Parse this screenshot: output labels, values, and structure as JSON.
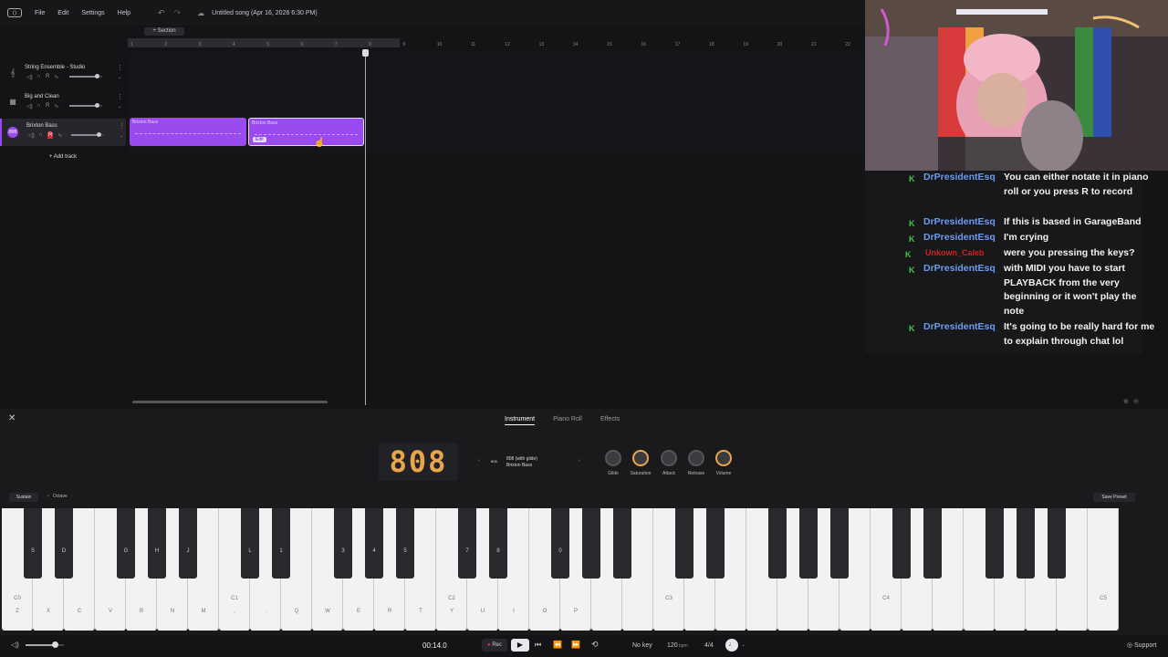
{
  "menu": {
    "items": [
      "File",
      "Edit",
      "Settings",
      "Help"
    ],
    "song_title": "Untitled song (Apr 16, 2026 6:30 PM)"
  },
  "arrangement": {
    "section_button": "+ Section",
    "ruler": [
      "1",
      "2",
      "3",
      "4",
      "5",
      "6",
      "7",
      "8",
      "9",
      "10",
      "11",
      "12",
      "13",
      "14",
      "15",
      "16",
      "17",
      "18",
      "19",
      "20",
      "21",
      "22"
    ],
    "tracks": [
      {
        "name": "String Ensemble - Studio",
        "icon": "violin-icon",
        "rec": "R"
      },
      {
        "name": "Big and Clean",
        "icon": "piano-icon",
        "rec": "R"
      },
      {
        "name": "Brixton Bass",
        "icon": "808-icon",
        "rec": "R"
      }
    ],
    "add_track": "+ Add track",
    "clips": [
      {
        "label": "Brixton Bass"
      },
      {
        "label": "Brixton Bass",
        "edit_label": "Edit"
      }
    ]
  },
  "panel": {
    "tabs": [
      "Instrument",
      "Piano Roll",
      "Effects"
    ],
    "active_tab": "Instrument",
    "instrument_logo": "808",
    "preset_badge": "808",
    "preset_line1": "808 (with glide)",
    "preset_line2": "Brixton Bass",
    "knobs": [
      "Glide",
      "Saturation",
      "Attack",
      "Release",
      "Volume"
    ],
    "sustain": "Sustain",
    "octave": "Octave",
    "save_preset": "Save Preset"
  },
  "keyboard": {
    "white_keys": [
      {
        "oct": "C0",
        "kb": "Z"
      },
      {
        "oct": "",
        "kb": "X"
      },
      {
        "oct": "",
        "kb": "C"
      },
      {
        "oct": "",
        "kb": "V"
      },
      {
        "oct": "",
        "kb": "B"
      },
      {
        "oct": "",
        "kb": "N"
      },
      {
        "oct": "",
        "kb": "M"
      },
      {
        "oct": "C1",
        "kb": ","
      },
      {
        "oct": "",
        "kb": "."
      },
      {
        "oct": "",
        "kb": "Q"
      },
      {
        "oct": "",
        "kb": "W"
      },
      {
        "oct": "",
        "kb": "E"
      },
      {
        "oct": "",
        "kb": "R"
      },
      {
        "oct": "",
        "kb": "T"
      },
      {
        "oct": "C2",
        "kb": "Y"
      },
      {
        "oct": "",
        "kb": "U"
      },
      {
        "oct": "",
        "kb": "I"
      },
      {
        "oct": "",
        "kb": "O"
      },
      {
        "oct": "",
        "kb": "P"
      },
      {
        "oct": "",
        "kb": ""
      },
      {
        "oct": "",
        "kb": ""
      },
      {
        "oct": "C3",
        "kb": ""
      },
      {
        "oct": "",
        "kb": ""
      },
      {
        "oct": "",
        "kb": ""
      },
      {
        "oct": "",
        "kb": ""
      },
      {
        "oct": "",
        "kb": ""
      },
      {
        "oct": "",
        "kb": ""
      },
      {
        "oct": "",
        "kb": ""
      },
      {
        "oct": "C4",
        "kb": ""
      },
      {
        "oct": "",
        "kb": ""
      },
      {
        "oct": "",
        "kb": ""
      },
      {
        "oct": "",
        "kb": ""
      },
      {
        "oct": "",
        "kb": ""
      },
      {
        "oct": "",
        "kb": ""
      },
      {
        "oct": "",
        "kb": ""
      },
      {
        "oct": "C5",
        "kb": ""
      }
    ],
    "black_keys": [
      "S",
      "D",
      "",
      "G",
      "H",
      "J",
      "",
      "L",
      "1",
      "",
      "3",
      "4",
      "5",
      "",
      "7",
      "8",
      "",
      "0",
      "",
      "",
      "",
      "",
      "",
      "",
      "",
      "",
      "",
      "",
      "",
      "",
      "",
      "",
      "",
      "",
      "",
      ""
    ]
  },
  "transport": {
    "time": "00:14.0",
    "rec": "Rec",
    "key": "No key",
    "bpm_value": "120",
    "bpm_unit": "bpm",
    "meter": "4/4",
    "support": "Support"
  },
  "chat": [
    {
      "user": "DrPresidentEsq",
      "user_color": "#6a9cf2",
      "text": "You can either notate it in piano roll or you press R to record"
    },
    {
      "user": "DrPresidentEsq",
      "user_color": "#6a9cf2",
      "text": "If this is based in GarageBand"
    },
    {
      "user": "DrPresidentEsq",
      "user_color": "#6a9cf2",
      "text": "I'm crying"
    },
    {
      "user": "Unkown_Caleb",
      "user_color": "#d02020",
      "text": "were you pressing the keys?"
    },
    {
      "user": "DrPresidentEsq",
      "user_color": "#6a9cf2",
      "text": "with MIDI you have to start PLAYBACK from the very beginning or it won't play the note"
    },
    {
      "user": "DrPresidentEsq",
      "user_color": "#6a9cf2",
      "text": "It's going to be really hard for me to explain through chat lol"
    }
  ]
}
